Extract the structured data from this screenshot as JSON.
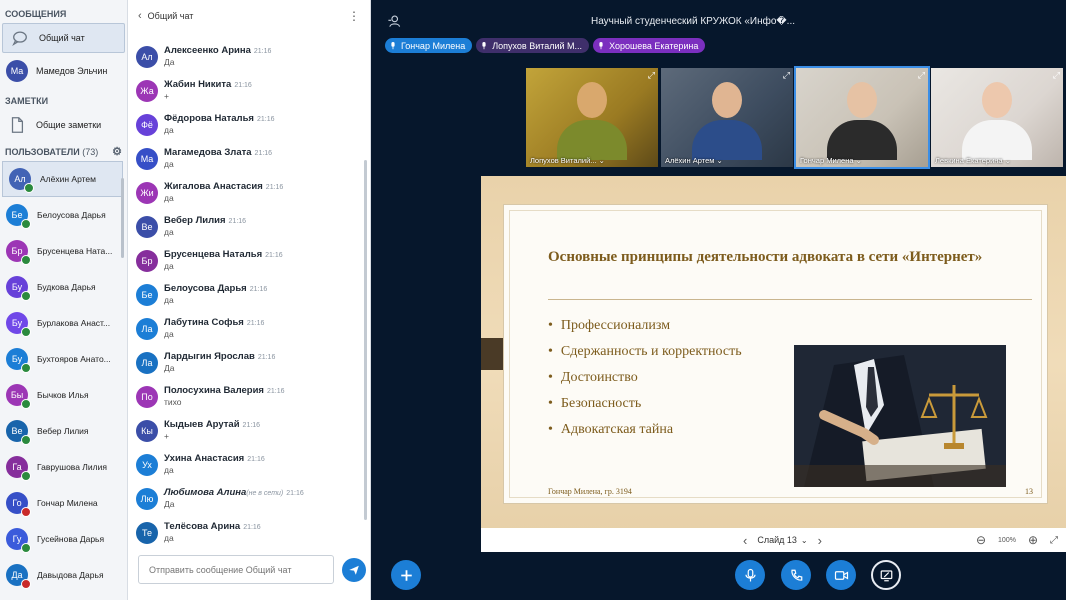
{
  "sidebar": {
    "messages_header": "СООБЩЕНИЯ",
    "public_chat": "Общий чат",
    "private_chat": {
      "initials": "Ма",
      "name": "Мамедов Эльчин",
      "color": "#3b4ea8"
    },
    "notes_header": "ЗАМЕТКИ",
    "shared_notes": "Общие заметки",
    "users_header": "ПОЛЬЗОВАТЕЛИ",
    "users_count": "(73)",
    "users": [
      {
        "initials": "Ал",
        "name": "Алёхин Артем",
        "color": "#4263b5",
        "status": "presenter"
      },
      {
        "initials": "Бе",
        "name": "Белоусова Дарья",
        "color": "#1c7ed6",
        "status": "on"
      },
      {
        "initials": "Бр",
        "name": "Брусенцева Ната...",
        "color": "#9c36b5",
        "status": "on"
      },
      {
        "initials": "Бу",
        "name": "Будкова Дарья",
        "color": "#6741d9",
        "status": "on"
      },
      {
        "initials": "Бу",
        "name": "Бурлакова Анаст...",
        "color": "#7048e8",
        "status": "on"
      },
      {
        "initials": "Бу",
        "name": "Бухтояров Анато...",
        "color": "#1c7ed6",
        "status": "on"
      },
      {
        "initials": "Бы",
        "name": "Бычков Илья",
        "color": "#9c36b5",
        "status": "on"
      },
      {
        "initials": "Ве",
        "name": "Вебер Лилия",
        "color": "#1864ab",
        "status": "on"
      },
      {
        "initials": "Га",
        "name": "Гаврушова Лилия",
        "color": "#862e9c",
        "status": "on"
      },
      {
        "initials": "Го",
        "name": "Гончар Милена",
        "color": "#364fc7",
        "status": "muted"
      },
      {
        "initials": "Гу",
        "name": "Гусейнова Дарья",
        "color": "#3b5bdb",
        "status": "on"
      },
      {
        "initials": "Да",
        "name": "Давыдова Дарья",
        "color": "#1971c2",
        "status": "muted"
      }
    ]
  },
  "chat": {
    "title": "Общий чат",
    "messages": [
      {
        "initials": "Ал",
        "name": "Алексеенко Арина",
        "time": "21:16",
        "text": "Да",
        "color": "#3b4ea8"
      },
      {
        "initials": "Жа",
        "name": "Жабин Никита",
        "time": "21:16",
        "text": "+",
        "color": "#9c36b5"
      },
      {
        "initials": "Фё",
        "name": "Фёдорова Наталья",
        "time": "21:16",
        "text": "да",
        "color": "#6741d9"
      },
      {
        "initials": "Ма",
        "name": "Магамедова Злата",
        "time": "21:16",
        "text": "да",
        "color": "#364fc7"
      },
      {
        "initials": "Жи",
        "name": "Жигалова Анастасия",
        "time": "21:16",
        "text": "да",
        "color": "#9c36b5"
      },
      {
        "initials": "Ве",
        "name": "Вебер Лилия",
        "time": "21:16",
        "text": "да",
        "color": "#3b4ea8"
      },
      {
        "initials": "Бр",
        "name": "Брусенцева Наталья",
        "time": "21:16",
        "text": "да",
        "color": "#862e9c"
      },
      {
        "initials": "Бе",
        "name": "Белоусова Дарья",
        "time": "21:16",
        "text": "да",
        "color": "#1c7ed6"
      },
      {
        "initials": "Ла",
        "name": "Лабутина Софья",
        "time": "21:16",
        "text": "да",
        "color": "#1c7ed6"
      },
      {
        "initials": "Ла",
        "name": "Лардыгин Ярослав",
        "time": "21:16",
        "text": "Да",
        "color": "#1971c2"
      },
      {
        "initials": "По",
        "name": "Полосухина Валерия",
        "time": "21:16",
        "text": "тихо",
        "color": "#9c36b5"
      },
      {
        "initials": "Кы",
        "name": "Кыдыев Арутай",
        "time": "21:16",
        "text": "+",
        "color": "#3b4ea8"
      },
      {
        "initials": "Ух",
        "name": "Ухина Анастасия",
        "time": "21:16",
        "text": "да",
        "color": "#1c7ed6"
      },
      {
        "initials": "Лю",
        "name": "Любимова Алина",
        "note": "(не в сети)",
        "time": "21:16",
        "text": "Да",
        "color": "#1c7ed6",
        "offline": true
      },
      {
        "initials": "Те",
        "name": "Телёсова Арина",
        "time": "21:16",
        "text": "да",
        "color": "#1864ab"
      }
    ],
    "input_placeholder": "Отправить сообщение Общий чат"
  },
  "main": {
    "title": "Научный студенческий КРУЖОК «Инфо�...",
    "talkers": [
      {
        "name": "Гончар Милена",
        "color": "#1c7ed6"
      },
      {
        "name": "Лопухов Виталий М...",
        "color": "#3f2f6b"
      },
      {
        "name": "Хорошева Екатерина",
        "color": "#7b2fbf"
      }
    ],
    "videos": [
      {
        "label": "Лопухов Виталий...",
        "bg": "bg1",
        "skin": "#d9a86d",
        "shirt": "#7c8a2c"
      },
      {
        "label": "Алёхин Артем",
        "bg": "bg2",
        "skin": "#e0b592",
        "shirt": "#2c4d8a"
      },
      {
        "label": "Гончар Милена",
        "bg": "bg3",
        "skin": "#e6c2a4",
        "shirt": "#2b2b2b",
        "active": true
      },
      {
        "label": "Левкина Екатерина",
        "bg": "bg4",
        "skin": "#edc8ad",
        "shirt": "#f4f4f4"
      }
    ],
    "slide": {
      "title": "Основные принципы деятельности адвоката в сети «Интернет»",
      "bullets": [
        "Профессионализм",
        "Сдержанность и корректность",
        "Достоинство",
        "Безопасность",
        "Адвокатская тайна"
      ],
      "footer": "Гончар Милена, гр. 3194",
      "number": "13"
    },
    "slide_control": "Слайд 13",
    "zoom": "100%"
  }
}
